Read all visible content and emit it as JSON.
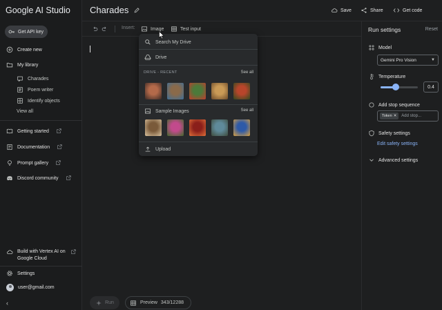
{
  "app": {
    "brand": "Google AI Studio",
    "doc_title": "Charades"
  },
  "sidebar": {
    "api_key": "Get API key",
    "create_new": "Create new",
    "my_library": "My library",
    "library_items": [
      "Charades",
      "Poem writer",
      "Identify objects"
    ],
    "view_all": "View all",
    "links": [
      "Getting started",
      "Documentation",
      "Prompt gallery",
      "Discord community"
    ],
    "vertex": "Build with Vertex AI on Google Cloud",
    "settings": "Settings",
    "user": "user@gmail.com",
    "collapse_glyph": "‹"
  },
  "header": {
    "save": "Save",
    "share": "Share",
    "get_code": "Get code"
  },
  "toolbar": {
    "insert": "Insert:",
    "image": "Image",
    "test_input": "Test input"
  },
  "menu": {
    "search_drive": "Search My Drive",
    "drive": "Drive",
    "drive_recent": "DRIVE - RECENT",
    "see_all_1": "See all",
    "sample_images": "Sample Images",
    "see_all_2": "See all",
    "upload": "Upload",
    "recent_thumbs": [
      {
        "name": "figurine",
        "c1": "#b46a4a",
        "c2": "#3a2a26"
      },
      {
        "name": "latte",
        "c1": "#8a6a4a",
        "c2": "#3d6f9a"
      },
      {
        "name": "salad",
        "c1": "#4c7a3a",
        "c2": "#c43b2e"
      },
      {
        "name": "soup-bowl",
        "c1": "#c99a56",
        "c2": "#6b4a2a"
      },
      {
        "name": "stir-fry",
        "c1": "#b8452b",
        "c2": "#2e4a1f"
      }
    ],
    "sample_thumbs": [
      {
        "name": "dog",
        "c1": "#7a5a3a",
        "c2": "#d9c3a0"
      },
      {
        "name": "flowers",
        "c1": "#c24a8c",
        "c2": "#3f6a2a"
      },
      {
        "name": "lantern",
        "c1": "#8a1f1a",
        "c2": "#e0703a"
      },
      {
        "name": "street",
        "c1": "#5f8a9a",
        "c2": "#3e4a3a"
      },
      {
        "name": "building",
        "c1": "#2e5aa8",
        "c2": "#d9a040"
      }
    ]
  },
  "run_settings": {
    "title": "Run settings",
    "reset": "Reset",
    "model_label": "Model",
    "model_value": "Gemini Pro Vision",
    "temperature_label": "Temperature",
    "temperature": 0.4,
    "temperature_display": "0.4",
    "stop_label": "Add stop sequence",
    "stop_chip": "Token",
    "stop_placeholder": "Add stop...",
    "safety_label": "Safety settings",
    "safety_link": "Edit safety settings",
    "advanced_label": "Advanced settings"
  },
  "footer": {
    "run": "Run",
    "preview": "Preview",
    "tokens": "343/12288"
  },
  "colors": {
    "accent": "#8ab4f8",
    "background": "#1e1f20",
    "menu": "#282a2c"
  }
}
